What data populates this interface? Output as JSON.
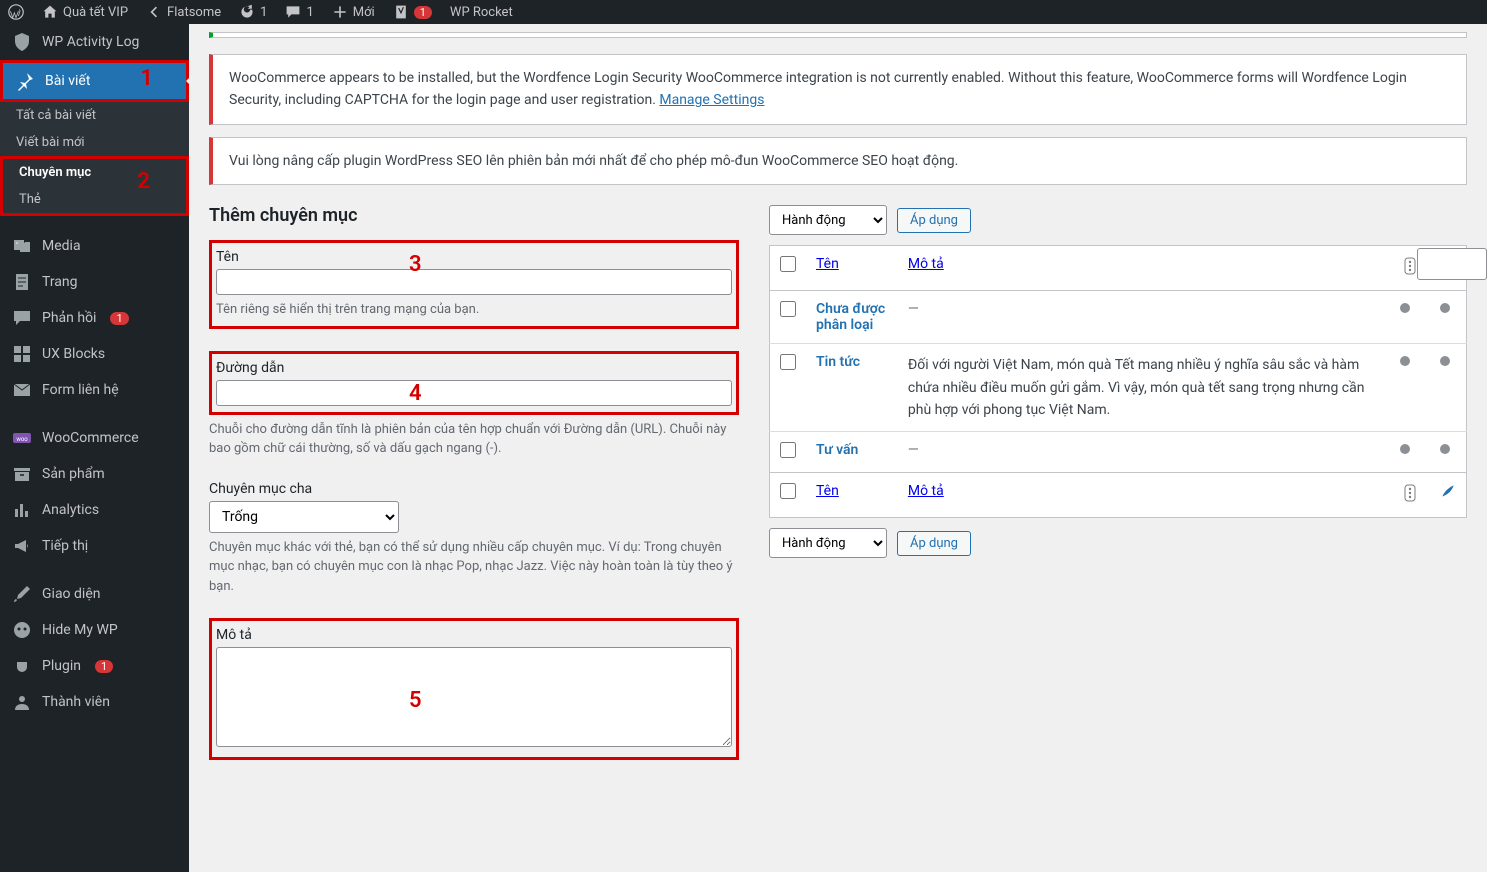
{
  "topbar": {
    "site_name": "Quà tết VIP",
    "theme_name": "Flatsome",
    "updates_count": "1",
    "comments_count": "1",
    "new_label": "Mới",
    "yoast_count": "1",
    "wprocket_label": "WP Rocket"
  },
  "annotations": {
    "a1": "1",
    "a2": "2",
    "a3": "3",
    "a4": "4",
    "a5": "5"
  },
  "sidebar": {
    "activity_log": "WP Activity Log",
    "posts": "Bài viết",
    "posts_sub": {
      "all": "Tất cả bài viết",
      "new": "Viết bài mới",
      "categories": "Chuyên mục",
      "tags": "Thẻ"
    },
    "media": "Media",
    "pages": "Trang",
    "comments": "Phản hồi",
    "comments_badge": "1",
    "ux_blocks": "UX Blocks",
    "forms": "Form liên hệ",
    "woocommerce": "WooCommerce",
    "products": "Sản phẩm",
    "analytics": "Analytics",
    "marketing": "Tiếp thị",
    "appearance": "Giao diện",
    "hidemywp": "Hide My WP",
    "plugins": "Plugin",
    "plugins_badge": "1",
    "users": "Thành viên"
  },
  "notices": {
    "wordfence": "WooCommerce appears to be installed, but the Wordfence Login Security WooCommerce integration is not currently enabled. Without this feature, WooCommerce forms will Wordfence Login Security, including CAPTCHA for the login page and user registration. ",
    "wordfence_link": "Manage Settings",
    "seo": "Vui lòng nâng cấp plugin WordPress SEO lên phiên bản mới nhất để cho phép mô-đun WooCommerce SEO hoạt động."
  },
  "form": {
    "heading": "Thêm chuyên mục",
    "name_label": "Tên",
    "name_help": "Tên riêng sẽ hiển thị trên trang mạng của bạn.",
    "slug_label": "Đường dẫn",
    "slug_help": "Chuỗi cho đường dẫn tĩnh là phiên bản của tên hợp chuẩn với Đường dẫn (URL). Chuỗi này bao gồm chữ cái thường, số và dấu gạch ngang (-).",
    "parent_label": "Chuyên mục cha",
    "parent_none": "Trống",
    "parent_help": "Chuyên mục khác với thẻ, bạn có thể sử dụng nhiều cấp chuyên mục. Ví dụ: Trong chuyên mục nhạc, bạn có chuyên mục con là nhạc Pop, nhạc Jazz. Việc này hoàn toàn là tùy theo ý bạn.",
    "desc_label": "Mô tả"
  },
  "table": {
    "bulk_label": "Hành động",
    "apply_label": "Áp dụng",
    "col_name": "Tên",
    "col_desc": "Mô tả",
    "rows": [
      {
        "name": "Chưa được phân loại",
        "desc": "—"
      },
      {
        "name": "Tin tức",
        "desc": "Đối với người Việt Nam, món quà Tết mang nhiều ý nghĩa sâu sắc và hàm chứa nhiều điều muốn gửi gắm. Vì vậy, món quà tết sang trọng nhưng cần phù hợp với phong tục Việt Nam."
      },
      {
        "name": "Tư vấn",
        "desc": "—"
      }
    ]
  }
}
